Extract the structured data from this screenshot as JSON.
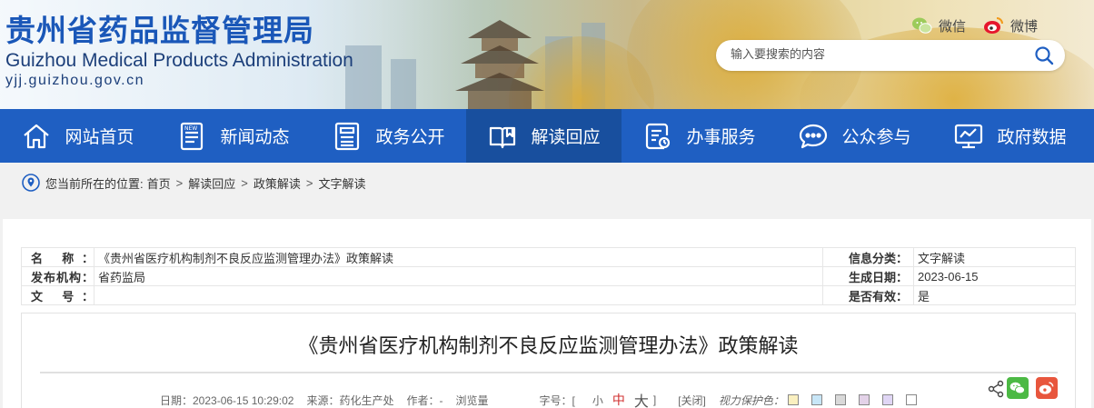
{
  "header": {
    "title": "贵州省药品监督管理局",
    "title_en": "Guizhou Medical Products Administration",
    "domain": "yjj.guizhou.gov.cn",
    "social": [
      {
        "icon": "wechat-icon",
        "label": "微信"
      },
      {
        "icon": "weibo-icon",
        "label": "微博"
      }
    ],
    "search": {
      "placeholder": "输入要搜索的内容",
      "value": ""
    }
  },
  "nav": {
    "items": [
      {
        "icon": "home-icon",
        "label": "网站首页"
      },
      {
        "icon": "news-icon",
        "label": "新闻动态"
      },
      {
        "icon": "document-icon",
        "label": "政务公开"
      },
      {
        "icon": "book-icon",
        "label": "解读回应",
        "active": true
      },
      {
        "icon": "service-icon",
        "label": "办事服务"
      },
      {
        "icon": "chat-icon",
        "label": "公众参与"
      },
      {
        "icon": "data-icon",
        "label": "政府数据"
      }
    ]
  },
  "breadcrumb": {
    "prefix": "您当前所在的位置:",
    "items": [
      "首页",
      "解读回应",
      "政策解读",
      "文字解读"
    ]
  },
  "meta": {
    "name_label": "名 称：",
    "name_value": "《贵州省医疗机构制剂不良反应监测管理办法》政策解读",
    "category_label": "信息分类：",
    "category_value": "文字解读",
    "issuer_label": "发布机构：",
    "issuer_value": "省药监局",
    "date_label": "生成日期：",
    "date_value": "2023-06-15",
    "docno_label": "文 号：",
    "docno_value": "",
    "valid_label": "是否有效：",
    "valid_value": "是"
  },
  "article": {
    "title": "《贵州省医疗机构制剂不良反应监测管理办法》政策解读",
    "date": "日期：2023-06-15 10:29:02",
    "source": "来源：药化生产处",
    "author": "作者：-",
    "views": "浏览量",
    "fontsize_label": "字号：[",
    "fontsize_small": "小",
    "fontsize_medium": "中",
    "fontsize_large": "大",
    "fontsize_end": "]",
    "close": "[关闭]",
    "eye_label": "视力保护色：",
    "eye_colors": [
      "#faf0c0",
      "#c8e6f7",
      "#d9d9d9",
      "#e3d2e8",
      "#e0d6f5",
      "#ffffff"
    ]
  },
  "colors": {
    "nav_bg": "#1f5fc2",
    "nav_active": "#184f9e",
    "title_blue": "#1a57b8"
  }
}
